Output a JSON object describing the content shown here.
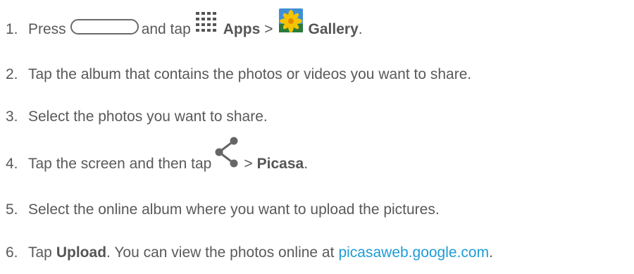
{
  "steps": [
    {
      "number": "1.",
      "press": "Press",
      "and_tap": "and tap",
      "apps": "Apps",
      "gt": ">",
      "gallery": "Gallery",
      "period": "."
    },
    {
      "number": "2.",
      "text": "Tap the album that contains the photos or videos you want to share."
    },
    {
      "number": "3.",
      "text": "Select the photos you want to share."
    },
    {
      "number": "4.",
      "lead": "Tap the screen and then tap",
      "gt": ">",
      "picasa": "Picasa",
      "period": "."
    },
    {
      "number": "5.",
      "text": "Select the online album where you want to upload the pictures."
    },
    {
      "number": "6.",
      "tap": "Tap",
      "upload": "Upload",
      "rest": ". You can view the photos online at",
      "link": "picasaweb.google.com",
      "period": "."
    }
  ],
  "icons": {
    "home_button": "home-button-icon",
    "apps": "apps-grid-icon",
    "gallery": "gallery-icon",
    "share": "share-icon"
  },
  "colors": {
    "text": "#595959",
    "link": "#1f9bd6",
    "gallery_sky": "#3f8fd6",
    "gallery_flower": "#f4c400"
  }
}
